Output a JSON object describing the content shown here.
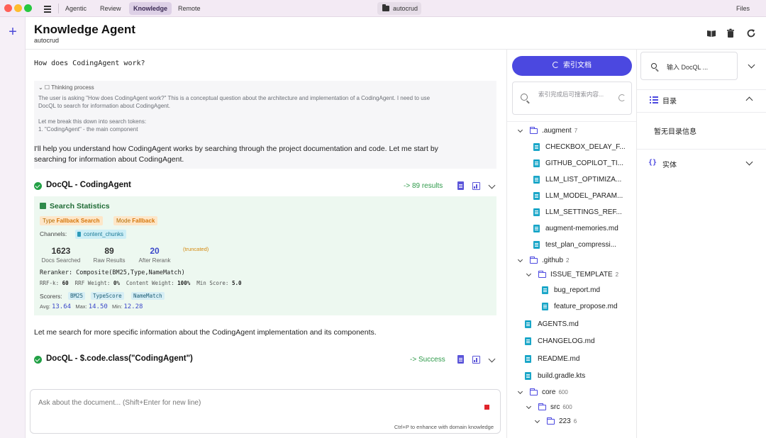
{
  "topbar": {
    "tabs": [
      {
        "label": "Agentic",
        "active": false
      },
      {
        "label": "Review",
        "active": false
      },
      {
        "label": "Knowledge",
        "active": true
      },
      {
        "label": "Remote",
        "active": false
      }
    ],
    "project": "autocrud",
    "files_label": "Files"
  },
  "header": {
    "title": "Knowledge Agent",
    "subtitle": "autocrud",
    "icons": [
      "book-icon",
      "trash-icon",
      "refresh-icon"
    ]
  },
  "chat": {
    "question": "How does CodingAgent work?",
    "thinking": {
      "label": "Thinking process",
      "line1": "The user is asking \"How does CodingAgent work?\" This is a conceptual question about the architecture and implementation of a CodingAgent. I need to use",
      "line2": "DocQL to search for information about CodingAgent.",
      "line3": "Let me break this down into search tokens:",
      "line4": "1. \"CodingAgent\" - the main component"
    },
    "msg1_line1": "I'll help you understand how CodingAgent works by searching through the project documentation and code. Let me start by",
    "msg1_line2": "searching for information about CodingAgent.",
    "tool1": {
      "name": "DocQL - CodingAgent",
      "result": "-> 89 results"
    },
    "stats": {
      "title": "Search Statistics",
      "type_label": "Type",
      "type_value": "Fallback Search",
      "mode_label": "Mode",
      "mode_value": "Fallback",
      "channels_label": "Channels:",
      "channel": "content_chunks",
      "docs_searched": "1623",
      "docs_searched_label": "Docs Searched",
      "raw_results": "89",
      "raw_results_label": "Raw Results",
      "after_rerank": "20",
      "after_rerank_label": "After Rerank",
      "truncated": "(truncated)",
      "reranker": "Reranker: Composite(BM25,Type,NameMatch)",
      "rrfk_label": "RRF-k:",
      "rrfk": "60",
      "rrf_weight_label": "RRF Weight:",
      "rrf_weight": "0%",
      "content_weight_label": "Content Weight:",
      "content_weight": "100%",
      "min_score_label": "Min Score:",
      "min_score": "5.0",
      "scorers_label": "Scorers:",
      "scorers": [
        "BM25",
        "TypeScore",
        "NameMatch"
      ],
      "avg_label": "Avg:",
      "avg": "13.64",
      "max_label": "Max:",
      "max": "14.50",
      "min_label": "Min:",
      "min": "12.28"
    },
    "msg2": "Let me search for more specific information about the CodingAgent implementation and its components.",
    "tool2": {
      "name": "DocQL - $.code.class(\"CodingAgent\")",
      "result": "-> Success"
    }
  },
  "composer": {
    "placeholder": "Ask about the document... (Shift+Enter for new line)",
    "hint": "Ctrl+P to enhance with domain knowledge"
  },
  "tree": {
    "index_button": "索引文档",
    "search_placeholder": "索引完成后可搜索内容...",
    "items": [
      {
        "label": ".augment",
        "count": "7"
      },
      {
        "label": "CHECKBOX_DELAY_F..."
      },
      {
        "label": "GITHUB_COPILOT_TI..."
      },
      {
        "label": "LLM_LIST_OPTIMIZA..."
      },
      {
        "label": "LLM_MODEL_PARAM..."
      },
      {
        "label": "LLM_SETTINGS_REF..."
      },
      {
        "label": "augment-memories.md"
      },
      {
        "label": "test_plan_compressi..."
      },
      {
        "label": ".github",
        "count": "2"
      },
      {
        "label": "ISSUE_TEMPLATE",
        "count": "2"
      },
      {
        "label": "bug_report.md"
      },
      {
        "label": "feature_propose.md"
      },
      {
        "label": "AGENTS.md"
      },
      {
        "label": "CHANGELOG.md"
      },
      {
        "label": "README.md"
      },
      {
        "label": "build.gradle.kts"
      },
      {
        "label": "core",
        "count": "600"
      },
      {
        "label": "src",
        "count": "600"
      },
      {
        "label": "223",
        "count": "6"
      }
    ]
  },
  "right": {
    "docql_placeholder": "输入 DocQL ...",
    "toc_title": "目录",
    "toc_empty": "暂无目录信息",
    "entities_title": "实体"
  },
  "colors": {
    "accent": "#4b48e0",
    "success": "#22a045",
    "file": "#1aa6c8"
  }
}
